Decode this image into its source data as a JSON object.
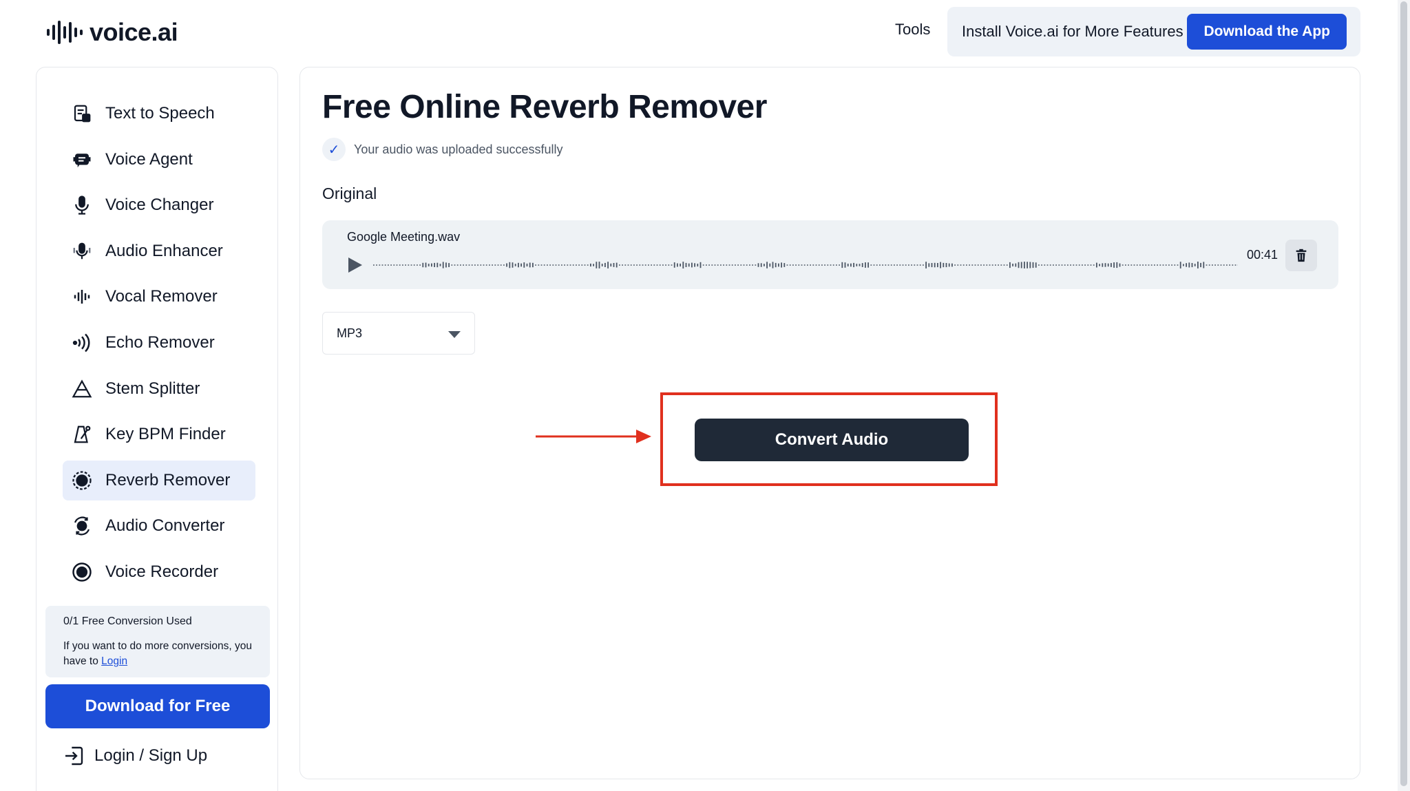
{
  "header": {
    "logo_text": "voice.ai",
    "tools_label": "Tools",
    "install_text": "Install Voice.ai for More Features",
    "download_app_label": "Download the App"
  },
  "sidebar": {
    "items": [
      {
        "label": "Text to Speech",
        "icon": "text-to-speech-icon"
      },
      {
        "label": "Voice Agent",
        "icon": "voice-agent-icon"
      },
      {
        "label": "Voice Changer",
        "icon": "microphone-icon"
      },
      {
        "label": "Audio Enhancer",
        "icon": "audio-enhancer-icon"
      },
      {
        "label": "Vocal Remover",
        "icon": "waveform-icon"
      },
      {
        "label": "Echo Remover",
        "icon": "echo-waves-icon"
      },
      {
        "label": "Stem Splitter",
        "icon": "triangle-split-icon"
      },
      {
        "label": "Key BPM Finder",
        "icon": "metronome-icon"
      },
      {
        "label": "Reverb Remover",
        "icon": "reverb-icon",
        "active": true
      },
      {
        "label": "Audio Converter",
        "icon": "convert-icon"
      },
      {
        "label": "Voice Recorder",
        "icon": "record-icon"
      }
    ],
    "free_box": {
      "title": "0/1 Free Conversion Used",
      "message": "If you want to do more conversions, you have to",
      "login_link": "Login"
    },
    "download_free_label": "Download for Free",
    "login_signup_label": "Login / Sign Up"
  },
  "main": {
    "title": "Free Online Reverb Remover",
    "upload_status": "Your audio was uploaded successfully",
    "original_label": "Original",
    "audio": {
      "file_name": "Google Meeting.wav",
      "duration": "00:41"
    },
    "format": {
      "selected": "MP3"
    },
    "convert_label": "Convert Audio"
  },
  "colors": {
    "accent": "#1d4ed8",
    "dark_button": "#1f2937",
    "highlight": "#e0301e"
  }
}
